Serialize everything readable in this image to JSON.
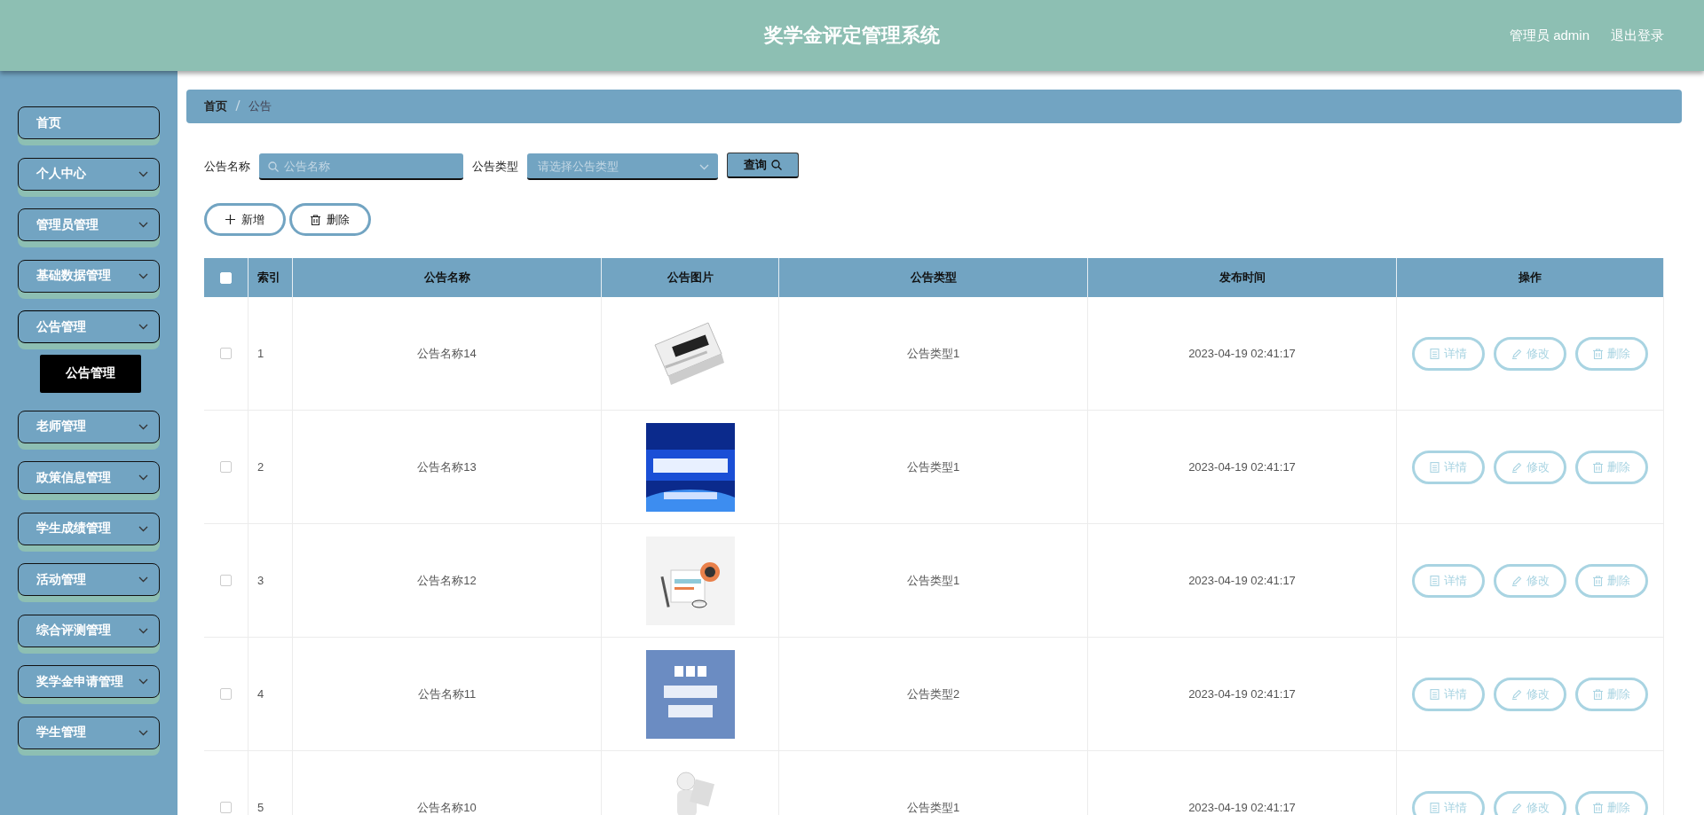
{
  "header": {
    "title": "奖学金评定管理系统",
    "user": "管理员 admin",
    "logout": "退出登录"
  },
  "sidebar": {
    "items": [
      {
        "label": "首页",
        "kind": "link"
      },
      {
        "label": "个人中心",
        "kind": "menu",
        "expanded": false
      },
      {
        "label": "管理员管理",
        "kind": "menu",
        "expanded": false
      },
      {
        "label": "基础数据管理",
        "kind": "menu",
        "expanded": false
      },
      {
        "label": "公告管理",
        "kind": "menu",
        "expanded": true,
        "children": [
          {
            "label": "公告管理",
            "selected": true
          }
        ]
      },
      {
        "label": "老师管理",
        "kind": "menu",
        "expanded": false
      },
      {
        "label": "政策信息管理",
        "kind": "menu",
        "expanded": false
      },
      {
        "label": "学生成绩管理",
        "kind": "menu",
        "expanded": false
      },
      {
        "label": "活动管理",
        "kind": "menu",
        "expanded": false
      },
      {
        "label": "综合评测管理",
        "kind": "menu",
        "expanded": false
      },
      {
        "label": "奖学金申请管理",
        "kind": "menu",
        "expanded": false
      },
      {
        "label": "学生管理",
        "kind": "menu",
        "expanded": false
      }
    ]
  },
  "breadcrumb": [
    "首页",
    "公告"
  ],
  "filters": {
    "name_label": "公告名称",
    "name_placeholder": "公告名称",
    "type_label": "公告类型",
    "type_placeholder": "请选择公告类型",
    "search_button": "查询"
  },
  "actions": [
    "新增",
    "删除"
  ],
  "table": {
    "header_checked": false,
    "columns": [
      "索引",
      "公告名称",
      "公告图片",
      "公告类型",
      "发布时间",
      "操作"
    ],
    "rows": [
      {
        "checked": false,
        "index": "1",
        "name": "公告名称14",
        "type": "公告类型1",
        "time": "2023-04-19 02:41:17",
        "actions": [
          "详情",
          "修改",
          "删除"
        ]
      },
      {
        "checked": false,
        "index": "2",
        "name": "公告名称13",
        "type": "公告类型1",
        "time": "2023-04-19 02:41:17",
        "actions": [
          "详情",
          "修改",
          "删除"
        ]
      },
      {
        "checked": false,
        "index": "3",
        "name": "公告名称12",
        "type": "公告类型1",
        "time": "2023-04-19 02:41:17",
        "actions": [
          "详情",
          "修改",
          "删除"
        ]
      },
      {
        "checked": false,
        "index": "4",
        "name": "公告名称11",
        "type": "公告类型2",
        "time": "2023-04-19 02:41:17",
        "actions": [
          "详情",
          "修改",
          "删除"
        ]
      },
      {
        "checked": false,
        "index": "5",
        "name": "公告名称10",
        "type": "公告类型1",
        "time": "2023-04-19 02:41:17",
        "actions": [
          "详情",
          "修改",
          "删除"
        ]
      }
    ]
  }
}
